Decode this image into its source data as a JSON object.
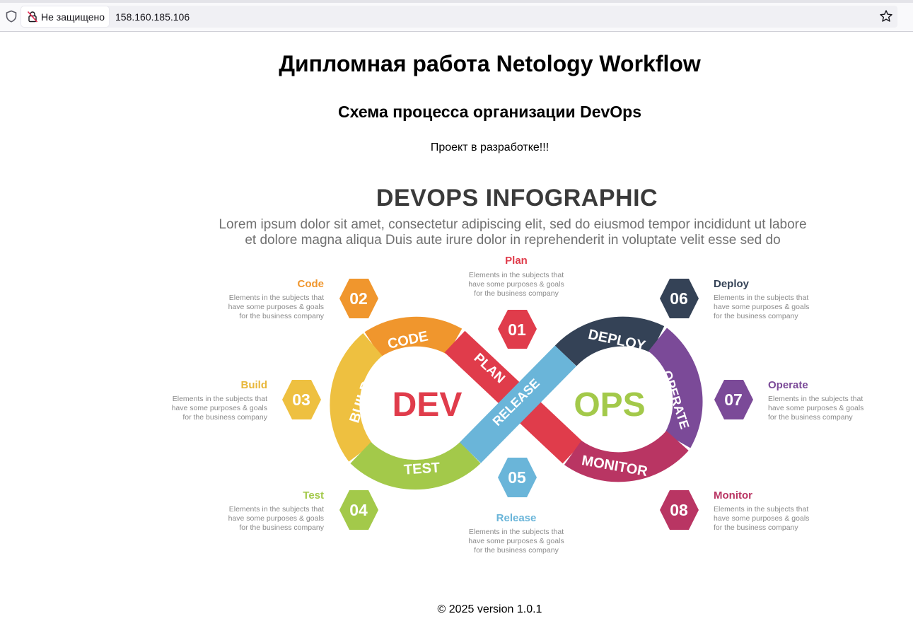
{
  "browser": {
    "security_label": "Не защищено",
    "url": "158.160.185.106"
  },
  "page": {
    "title": "Дипломная работа Netology Workflow",
    "subtitle": "Схема процесса организации DevOps",
    "note": "Проект в разработке!!!",
    "footer": "© 2025 version 1.0.1"
  },
  "infographic": {
    "title": "DEVOPS INFOGRAPHIC",
    "subtitle_line1": "Lorem ipsum dolor sit amet, consectetur adipiscing elit, sed do eiusmod tempor incididunt ut labore",
    "subtitle_line2": "et dolore magna aliqua Duis aute irure dolor in reprehenderit in voluptate velit esse sed do",
    "dev_label": "DEV",
    "ops_label": "OPS",
    "loop_labels": {
      "plan": "PLAN",
      "code": "CODE",
      "build": "BUILD",
      "test": "TEST",
      "release": "RELEASE",
      "deploy": "DEPLOY",
      "operate": "OPERATE",
      "monitor": "MONITOR"
    },
    "steps": [
      {
        "num": "01",
        "title": "Plan",
        "desc": "Elements in the subjects that have some purposes & goals for the business company",
        "color": "#e03c4b"
      },
      {
        "num": "02",
        "title": "Code",
        "desc": "Elements in the subjects that have some purposes & goals for the business company",
        "color": "#f0962d"
      },
      {
        "num": "03",
        "title": "Build",
        "desc": "Elements in the subjects that have some purposes & goals for the business company",
        "color": "#eec040"
      },
      {
        "num": "04",
        "title": "Test",
        "desc": "Elements in the subjects that have some purposes & goals for the business company",
        "color": "#a3c94a"
      },
      {
        "num": "05",
        "title": "Release",
        "desc": "Elements in the subjects that have some purposes & goals for the business company",
        "color": "#6ab5d9"
      },
      {
        "num": "06",
        "title": "Deploy",
        "desc": "Elements in the subjects that have some purposes & goals for the business company",
        "color": "#344256"
      },
      {
        "num": "07",
        "title": "Operate",
        "desc": "Elements in the subjects that have some purposes & goals for the business company",
        "color": "#7b4a98"
      },
      {
        "num": "08",
        "title": "Monitor",
        "desc": "Elements in the subjects that have some purposes & goals for the business company",
        "color": "#b93563"
      }
    ],
    "colors": {
      "dev_text": "#e03c4b",
      "ops_text": "#a3c94a"
    }
  }
}
